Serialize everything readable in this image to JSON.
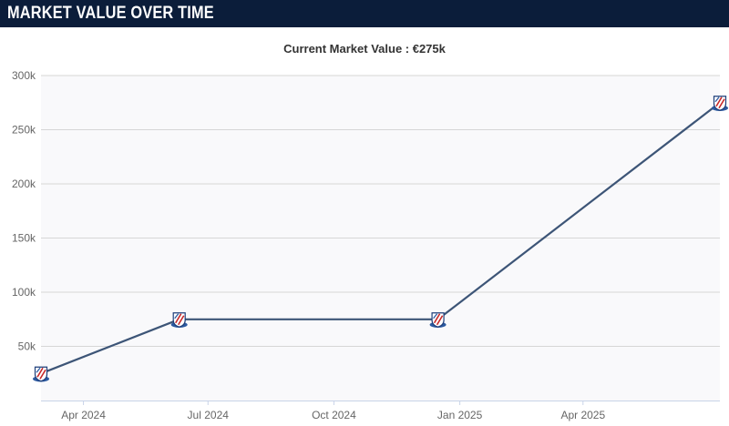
{
  "header": {
    "title": "MARKET VALUE OVER TIME"
  },
  "chart_data": {
    "type": "line",
    "title": "Current Market Value : €275k",
    "xlabel": "",
    "ylabel": "",
    "x_ticks": [
      "Apr 2024",
      "Jul 2024",
      "Oct 2024",
      "Jan 2025",
      "Apr 2025"
    ],
    "y_ticks": [
      "50k",
      "100k",
      "150k",
      "200k",
      "250k",
      "300k"
    ],
    "ylim": [
      0,
      300000
    ],
    "xlim": [
      "2024-03-01",
      "2025-07-10"
    ],
    "grid": true,
    "series": [
      {
        "color": "#3d5577",
        "points": [
          {
            "x": "2024-03-01",
            "y": 25000
          },
          {
            "x": "2024-06-10",
            "y": 75000
          },
          {
            "x": "2024-12-16",
            "y": 75000
          },
          {
            "x": "2025-07-10",
            "y": 275000
          }
        ]
      }
    ],
    "marker": "club-crest-icon",
    "colors": {
      "line": "#3d5577",
      "plot_bg": "#f9f9fb",
      "grid": "#d6d6d6",
      "axis": "#c8d3e8"
    }
  }
}
